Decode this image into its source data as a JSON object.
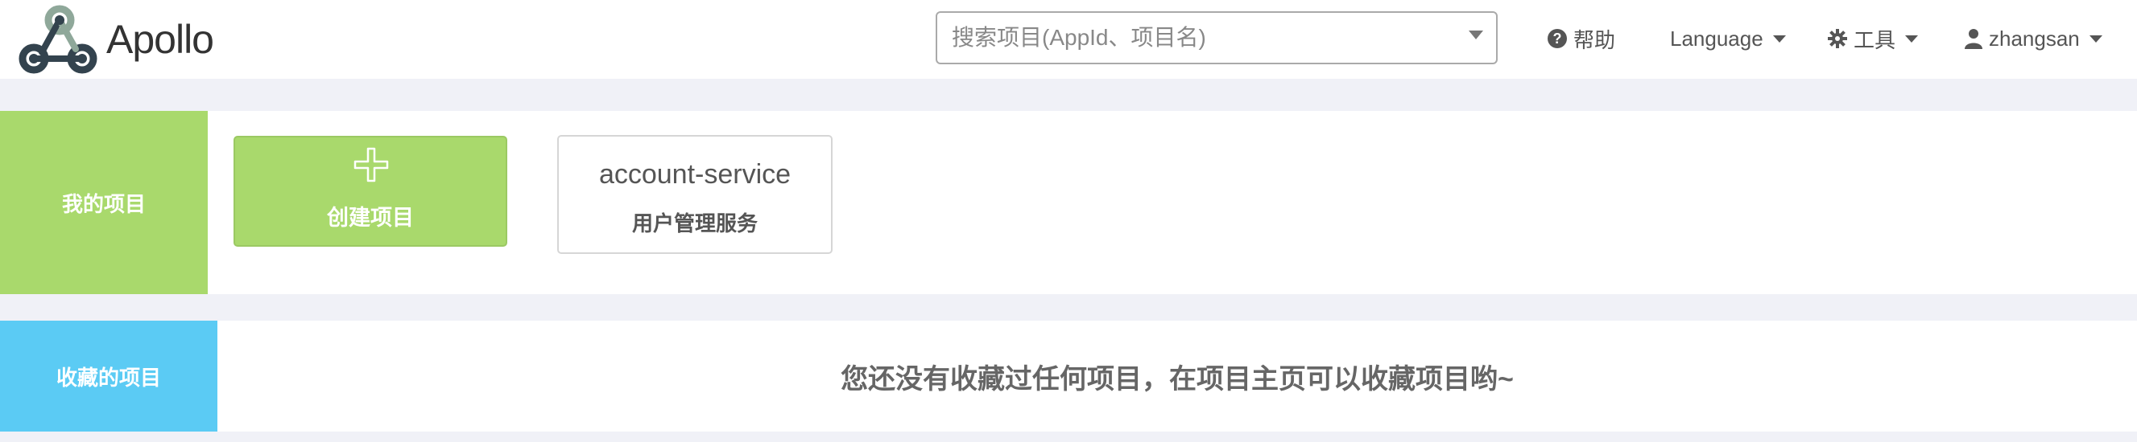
{
  "brand": {
    "name": "Apollo",
    "logo_icon": "apollo-webhook-logo",
    "logo_color": "#33434e",
    "logo_accent": "#8fa89a"
  },
  "search": {
    "placeholder": "搜索项目(AppId、项目名)",
    "value": ""
  },
  "nav": {
    "help_label": "帮助",
    "help_icon": "question-circle-icon",
    "language_label": "Language",
    "tools_label": "工具",
    "tools_icon": "gear-icon",
    "user_label": "zhangsan",
    "user_icon": "user-icon"
  },
  "my_projects": {
    "section_label": "我的项目",
    "accent_color": "#a9d96c",
    "create_label": "创建项目",
    "create_icon": "plus-icon",
    "projects": [
      {
        "app_id": "account-service",
        "name": "用户管理服务"
      }
    ]
  },
  "favorites": {
    "section_label": "收藏的项目",
    "accent_color": "#5bcbf4",
    "empty_message": "您还没有收藏过任何项目，在项目主页可以收藏项目哟~"
  }
}
